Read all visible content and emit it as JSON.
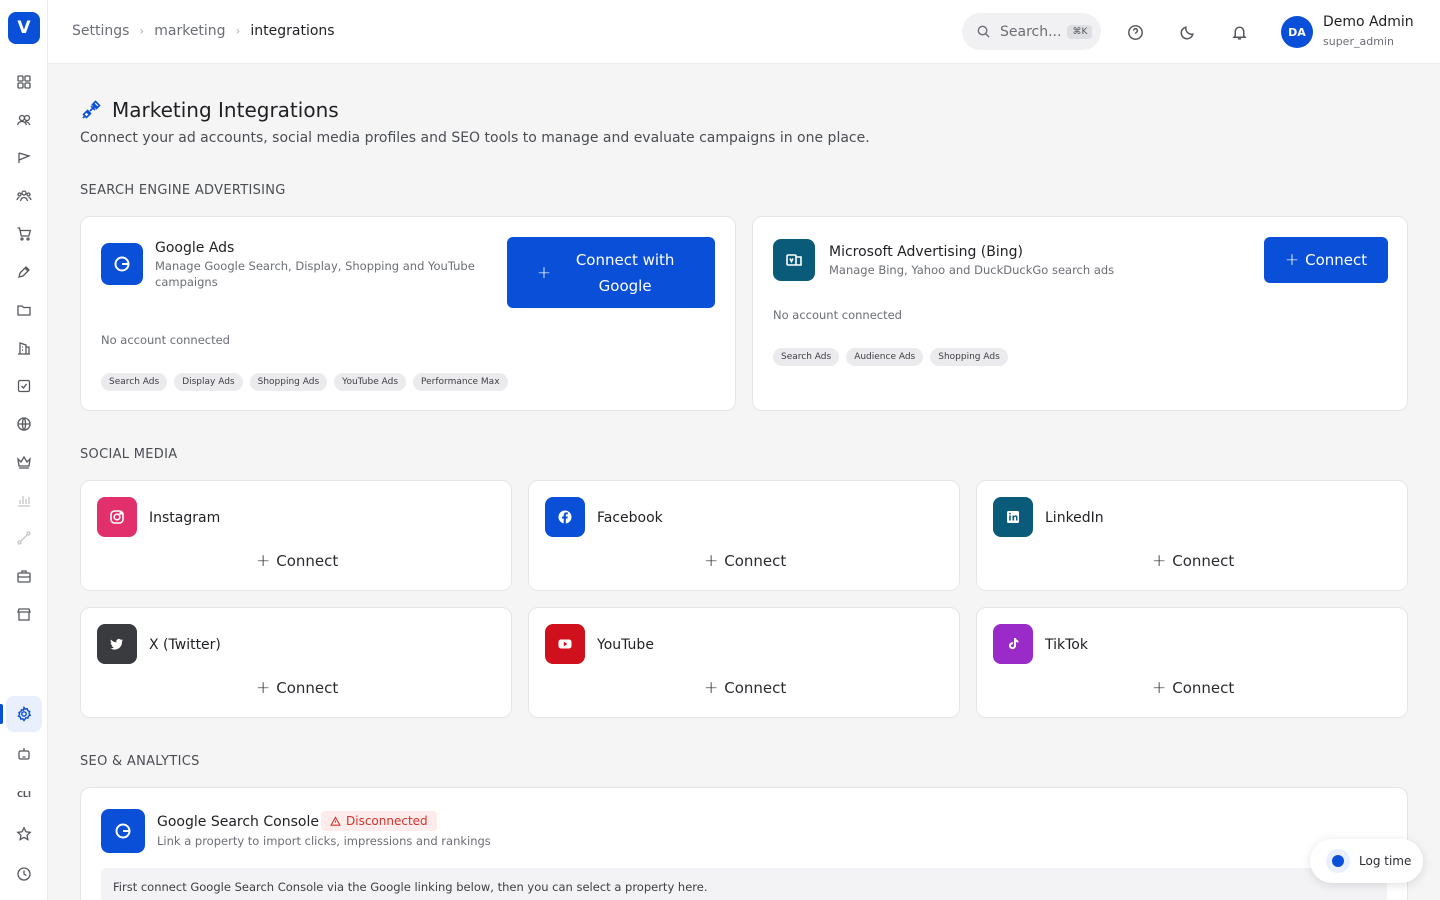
{
  "app": {
    "logo_letter": "V",
    "brand_color": "#0a4fd8"
  },
  "sidebar": {
    "icons": [
      "dashboard-icon",
      "users-icon",
      "campaign-icon",
      "team-icon",
      "cart-icon",
      "pen-icon",
      "folder-icon",
      "building-icon",
      "checklist-icon",
      "globe-icon",
      "crown-icon",
      "chart-icon",
      "route-icon",
      "briefcase-icon",
      "store-icon",
      "settings-icon",
      "robot-icon",
      "cli-icon",
      "star-icon",
      "clock-icon"
    ],
    "cli_label": "CLI",
    "active": "settings-icon"
  },
  "header": {
    "breadcrumb": [
      "Settings",
      "marketing",
      "integrations"
    ],
    "search_placeholder": "Search...",
    "search_shortcut": "⌘K",
    "user_initials": "DA",
    "user_name": "Demo Admin",
    "user_role": "super_admin"
  },
  "page": {
    "title": "Marketing Integrations",
    "subtitle": "Connect your ad accounts, social media profiles and SEO tools to manage and evaluate campaigns in one place."
  },
  "sections": {
    "sea": "SEARCH ENGINE ADVERTISING",
    "social": "SOCIAL MEDIA",
    "seo": "SEO & ANALYTICS"
  },
  "google_ads": {
    "name": "Google Ads",
    "description": "Manage Google Search, Display, Shopping and YouTube campaigns",
    "status": "No account connected",
    "button_line1": "Connect with",
    "button_line2": "Google",
    "tags": [
      "Search Ads",
      "Display Ads",
      "Shopping Ads",
      "YouTube Ads",
      "Performance Max"
    ]
  },
  "microsoft_ads": {
    "name": "Microsoft Advertising (Bing)",
    "description": "Manage Bing, Yahoo and DuckDuckGo search ads",
    "status": "No account connected",
    "button": "Connect",
    "tags": [
      "Search Ads",
      "Audience Ads",
      "Shopping Ads"
    ]
  },
  "social": [
    {
      "name": "Instagram",
      "connect": "Connect",
      "color": "#e1306c"
    },
    {
      "name": "Facebook",
      "connect": "Connect",
      "color": "#0a4fd8"
    },
    {
      "name": "LinkedIn",
      "connect": "Connect",
      "color": "#0a5a7a"
    },
    {
      "name": "X (Twitter)",
      "connect": "Connect",
      "color": "#3a3b3f"
    },
    {
      "name": "YouTube",
      "connect": "Connect",
      "color": "#d0101d"
    },
    {
      "name": "TikTok",
      "connect": "Connect",
      "color": "#9b2bc8"
    }
  ],
  "gsc": {
    "name": "Google Search Console",
    "badge": "Disconnected",
    "description": "Link a property to import clicks, impressions and rankings",
    "info": "First connect Google Search Console via the Google linking below, then you can select a property here."
  },
  "log_time": "Log time"
}
